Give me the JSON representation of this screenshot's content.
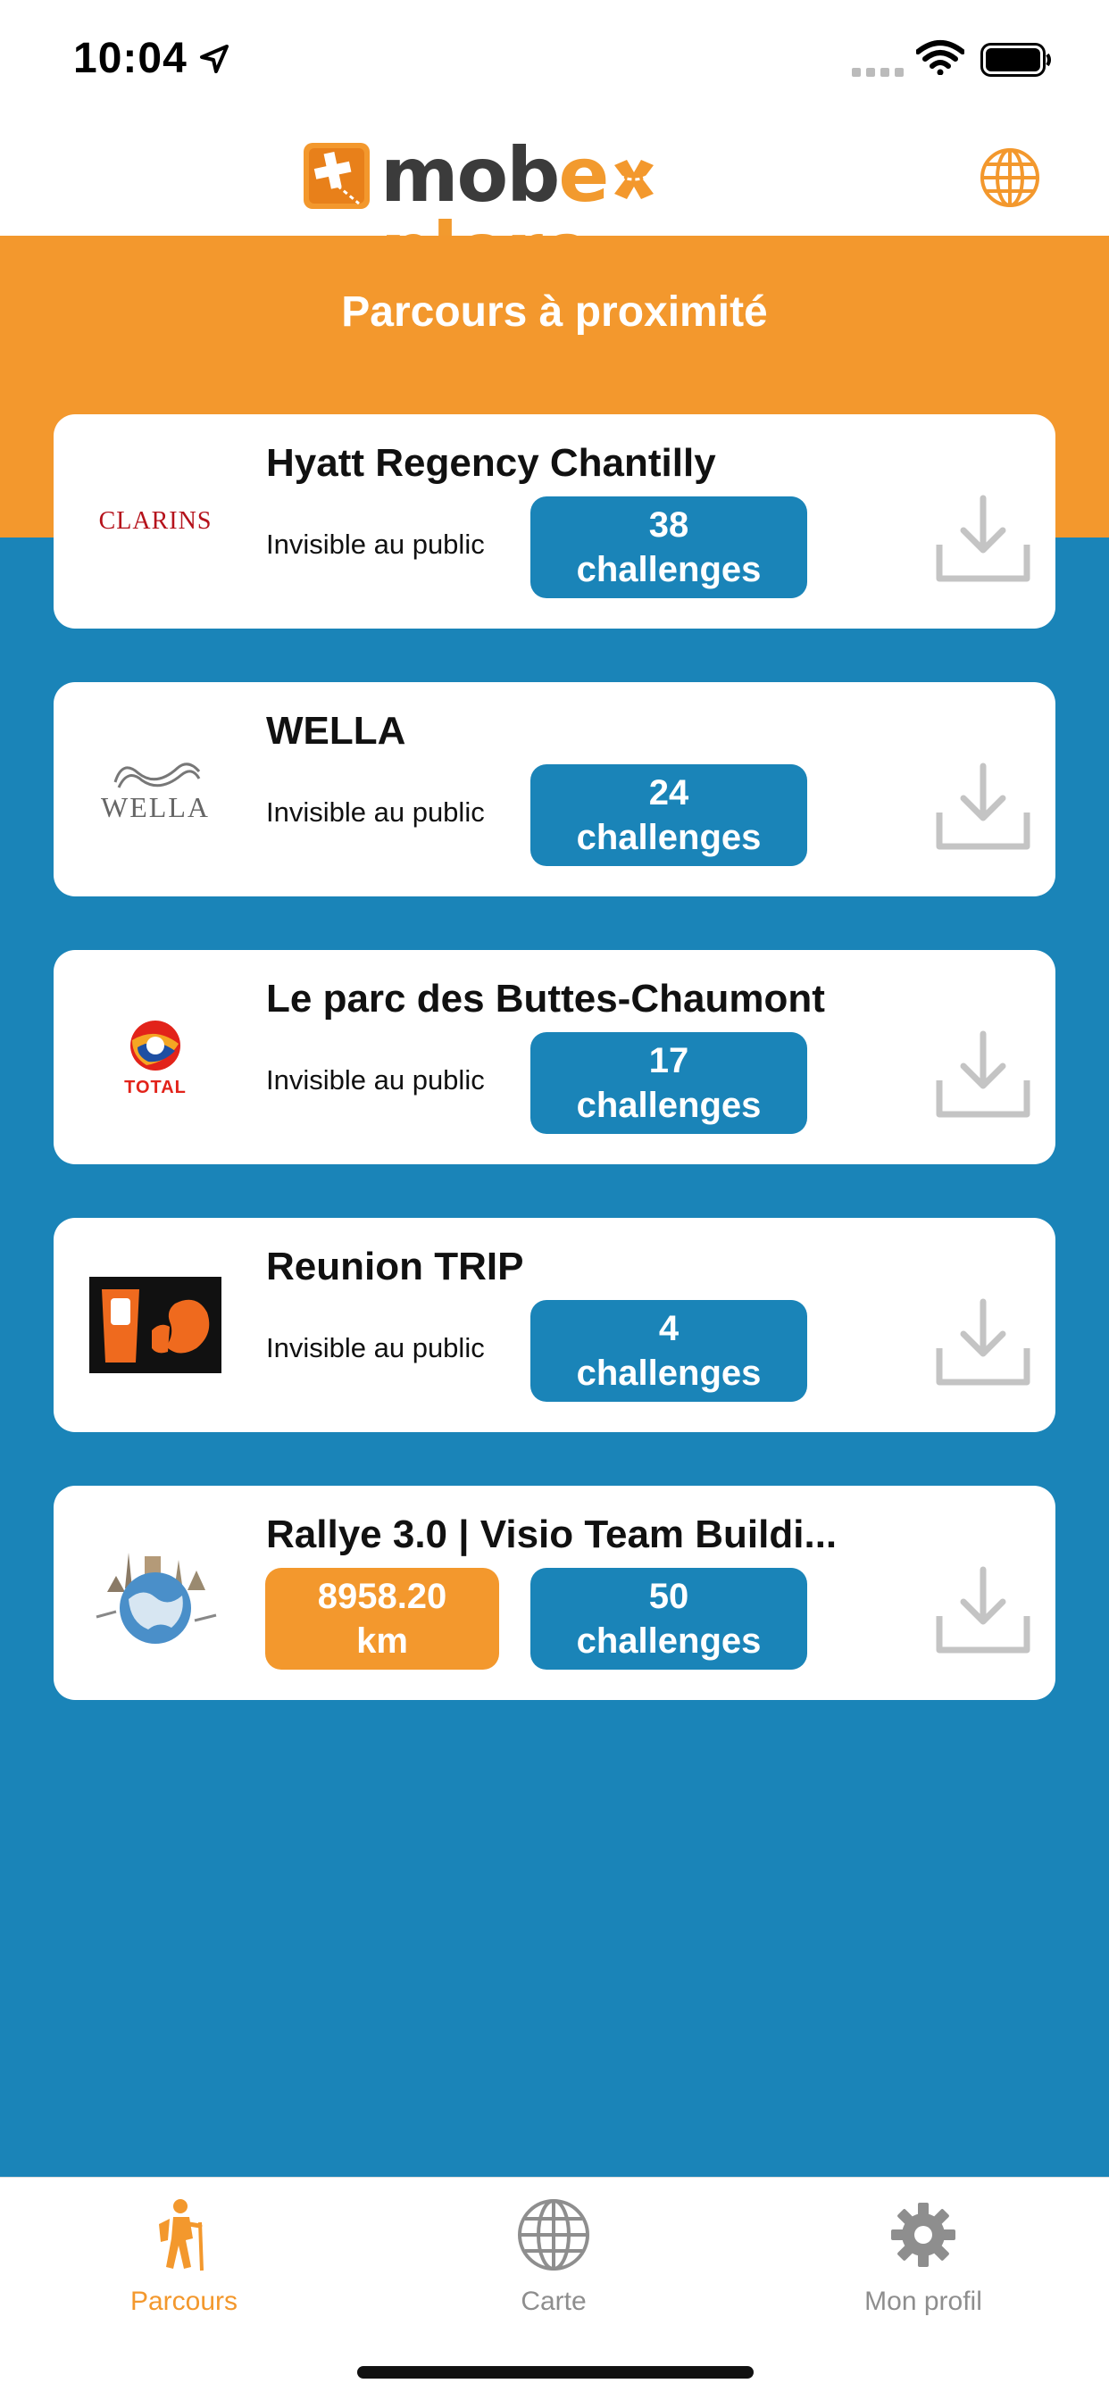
{
  "status_bar": {
    "time": "10:04"
  },
  "header": {
    "logo_part1": "mob",
    "logo_part2": "e",
    "logo_part3": "plore"
  },
  "page": {
    "title": "Parcours à proximité"
  },
  "courses": [
    {
      "title": "Hyatt Regency Chantilly",
      "subtitle": "Invisible au public",
      "count": "38",
      "unit": "challenges",
      "logo": "CLARINS"
    },
    {
      "title": "WELLA",
      "subtitle": "Invisible au public",
      "count": "24",
      "unit": "challenges",
      "logo": "WELLA"
    },
    {
      "title": "Le parc des Buttes-Chaumont",
      "subtitle": "Invisible au public",
      "count": "17",
      "unit": "challenges",
      "logo": "TOTAL"
    },
    {
      "title": "Reunion TRIP",
      "subtitle": "Invisible au public",
      "count": "4",
      "unit": "challenges",
      "logo": "squirrel-logo"
    },
    {
      "title": "Rallye 3.0 | Visio Team Buildi...",
      "distance": "8958.20",
      "distance_unit": "km",
      "count": "50",
      "unit": "challenges",
      "logo": "world-landmarks-logo"
    }
  ],
  "tabs": [
    {
      "label": "Parcours",
      "icon": "hiker-icon",
      "active": true
    },
    {
      "label": "Carte",
      "icon": "globe-icon",
      "active": false
    },
    {
      "label": "Mon profil",
      "icon": "gear-icon",
      "active": false
    }
  ],
  "colors": {
    "accent": "#f3982d",
    "primary": "#1a84b8",
    "inactive": "#8e8e8e"
  }
}
